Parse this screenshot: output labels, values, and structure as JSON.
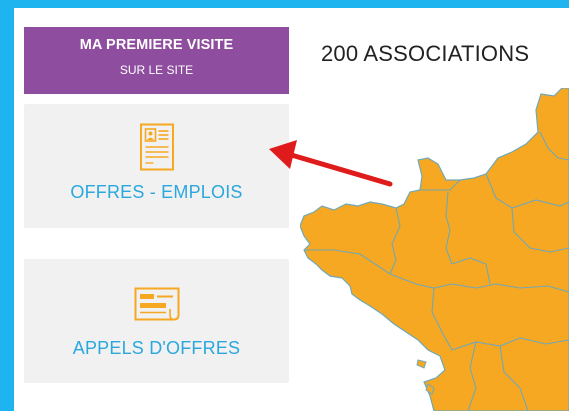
{
  "visit_button": {
    "title": "MA PREMIERE VISITE",
    "subtitle": "SUR LE SITE"
  },
  "cards": [
    {
      "label": "OFFRES - EMPLOIS",
      "icon": "job-offer-document-icon"
    },
    {
      "label": "APPELS D'OFFRES",
      "icon": "tender-document-icon"
    }
  ],
  "map": {
    "title": "200 ASSOCIATIONS"
  },
  "colors": {
    "frame": "#1eb4ef",
    "visit_bg": "#8f4d9f",
    "card_bg": "#f1f1f1",
    "card_text": "#2aa8de",
    "icon": "#f7a823",
    "map_fill": "#f7a823",
    "map_border": "#6fa8b6",
    "arrow": "#e01b1b"
  }
}
